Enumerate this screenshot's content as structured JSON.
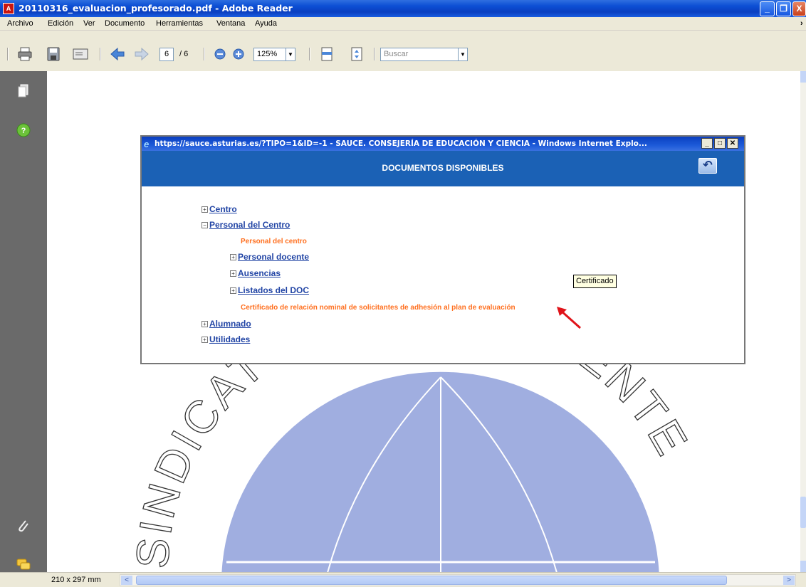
{
  "window": {
    "title": "20110316_evaluacion_profesorado.pdf - Adobe Reader"
  },
  "menu": {
    "items": [
      "Archivo",
      "Edición",
      "Ver",
      "Documento",
      "Herramientas",
      "Ventana",
      "Ayuda"
    ]
  },
  "toolbar": {
    "page_current": "6",
    "page_total": "/ 6",
    "zoom": "125%",
    "search_placeholder": "Buscar"
  },
  "status": {
    "page_size": "210 x 297 mm"
  },
  "ie_window": {
    "title": "https://sauce.asturias.es/?TIPO=1&ID=-1 - SAUCE. CONSEJERÍA DE EDUCACIÓN Y CIENCIA - Windows Internet Explo...",
    "heading": "DOCUMENTOS DISPONIBLES",
    "tree": {
      "centro": "Centro",
      "personal_centro": "Personal del Centro",
      "personal_centro_desc": "Personal del centro",
      "personal_docente": "Personal docente",
      "ausencias": "Ausencias",
      "listados_doc": "Listados del DOC",
      "certificado_desc": "Certificado de relación nominal de solicitantes de adhesión al plan de evaluación",
      "alumnado": "Alumnado",
      "utilidades": "Utilidades"
    },
    "tooltip": "Certificado"
  },
  "watermark": {
    "text": "SINDICATO INDEPENDIENTE"
  },
  "colors": {
    "xp_title_blue": "#0c4fd4",
    "ie_header_blue": "#1b61b5",
    "link_blue": "#2245a5",
    "orange_text": "#ff7020",
    "watermark_blue": "#8fa0da",
    "left_panel_gray": "#6a6a6a"
  }
}
